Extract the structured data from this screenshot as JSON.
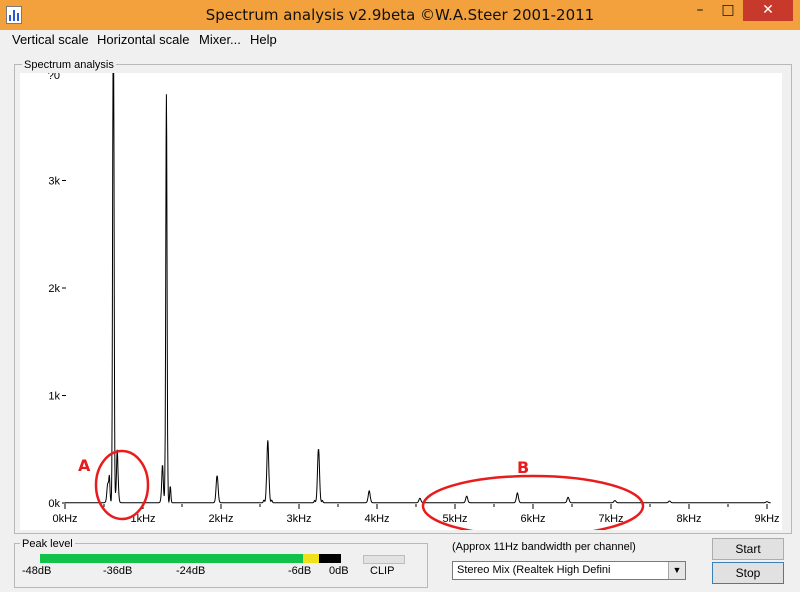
{
  "window": {
    "title": "Spectrum analysis v2.9beta    ©W.A.Steer 2001-2011",
    "controls": {
      "minimize": "–",
      "maximize": "□",
      "close": "✕"
    }
  },
  "menu": [
    "Vertical scale",
    "Horizontal scale",
    "Mixer...",
    "Help"
  ],
  "spectrum_panel": {
    "label": "Spectrum analysis",
    "y_axis_labels": [
      "0k",
      "1k",
      "2k",
      "3k",
      "?0"
    ],
    "x_axis_labels": [
      "0kHz",
      "1kHz",
      "2kHz",
      "3kHz",
      "4kHz",
      "5kHz",
      "6kHz",
      "7kHz",
      "8kHz",
      "9kHz"
    ],
    "annotations": [
      {
        "label": "A",
        "color": "#e81c1c"
      },
      {
        "label": "B",
        "color": "#e81c1c"
      }
    ],
    "trace_color": "#000000"
  },
  "peak_level": {
    "label": "Peak level",
    "scale_labels": [
      "-48dB",
      "-36dB",
      "-24dB",
      "-6dB",
      "0dB",
      "CLIP"
    ],
    "green_fraction": 0.873,
    "yellow_fraction": 0.053,
    "black_fraction": 0.074,
    "colors": {
      "green": "#13c24a",
      "yellow": "#f0e21a",
      "black": "#000000"
    }
  },
  "bandwidth_note": "(Approx 11Hz bandwidth per channel)",
  "device_select": {
    "value": "Stereo Mix (Realtek High Defini",
    "arrow": "▼"
  },
  "buttons": {
    "start": "Start",
    "stop": "Stop"
  },
  "chart_data": {
    "type": "line",
    "title": "",
    "xlabel": "",
    "ylabel": "",
    "x_unit": "kHz",
    "xlim": [
      0,
      9
    ],
    "ylim": [
      0,
      3800
    ],
    "x_ticks": [
      0,
      1,
      2,
      3,
      4,
      5,
      6,
      7,
      8,
      9
    ],
    "y_ticks": [
      0,
      1000,
      2000,
      3000
    ],
    "peaks": [
      {
        "x": 0.55,
        "y": 180
      },
      {
        "x": 0.62,
        "y": 5000
      },
      {
        "x": 0.67,
        "y": 300
      },
      {
        "x": 1.25,
        "y": 200
      },
      {
        "x": 1.3,
        "y": 3800
      },
      {
        "x": 1.95,
        "y": 250
      },
      {
        "x": 2.6,
        "y": 580
      },
      {
        "x": 3.25,
        "y": 500
      },
      {
        "x": 3.9,
        "y": 110
      },
      {
        "x": 4.55,
        "y": 40
      },
      {
        "x": 5.15,
        "y": 60
      },
      {
        "x": 5.8,
        "y": 90
      },
      {
        "x": 6.45,
        "y": 50
      },
      {
        "x": 7.05,
        "y": 20
      },
      {
        "x": 7.75,
        "y": 15
      },
      {
        "x": 9.0,
        "y": 10
      }
    ]
  }
}
